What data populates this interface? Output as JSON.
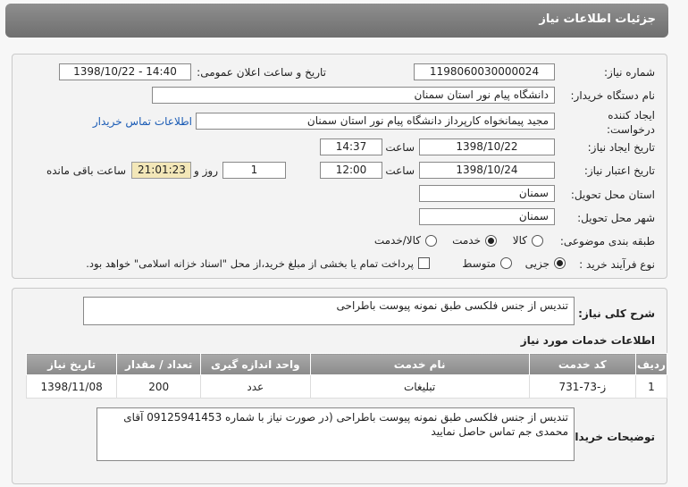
{
  "header": {
    "title": "جزئیات اطلاعات نیاز"
  },
  "fields": {
    "need_number_label": "شماره نیاز:",
    "need_number": "1198060030000024",
    "announce_label": "تاریخ و ساعت اعلان عمومی:",
    "announce_value": "1398/10/22 - 14:40",
    "buyer_label": "نام دستگاه خریدار:",
    "buyer_value": "دانشگاه  پیام نور استان سمنان",
    "creator_label_1": "ایجاد کننده",
    "creator_label_2": "درخواست:",
    "creator_value": "مجید پیمانخواه کارپرداز دانشگاه  پیام نور استان سمنان",
    "contact_link": "اطلاعات تماس خریدار",
    "create_date_label": "تاریخ ایجاد نیاز:",
    "create_date": "1398/10/22",
    "time_label": "ساعت",
    "create_time": "14:37",
    "valid_date_label": "تاریخ اعتبار نیاز:",
    "valid_date": "1398/10/24",
    "valid_time": "12:00",
    "days": "1",
    "days_label": "روز و",
    "remaining": "21:01:23",
    "remaining_label": "ساعت باقی مانده",
    "province_label": "استان محل تحویل:",
    "province": "سمنان",
    "city_label": "شهر محل تحویل:",
    "city": "سمنان",
    "category_label": "طبقه بندی موضوعی:",
    "category_options": [
      "کالا",
      "خدمت",
      "کالا/خدمت"
    ],
    "category_selected": "خدمت",
    "process_label": "نوع فرآیند خرید :",
    "process_options": [
      "جزیی",
      "متوسط"
    ],
    "process_selected": "جزیی",
    "payment_note": "پرداخت تمام یا بخشی از مبلغ خرید،از محل \"اسناد خزانه اسلامی\" خواهد بود."
  },
  "description": {
    "label": "شرح کلی نیاز:",
    "value": "تندیس از جنس فلکسی طبق نمونه پیوست باطراحی"
  },
  "services": {
    "title": "اطلاعات خدمات مورد نیاز",
    "columns": [
      "ردیف",
      "کد خدمت",
      "نام خدمت",
      "واحد اندازه گیری",
      "تعداد / مقدار",
      "تاریخ نیاز"
    ],
    "rows": [
      [
        "1",
        "ز-73-731",
        "تبلیغات",
        "عدد",
        "200",
        "1398/11/08"
      ]
    ]
  },
  "buyer_notes": {
    "label": "توضیحات خریدار:",
    "value": "تندیس از جنس فلکسی طبق نمونه پیوست باطراحی (در صورت نیاز با شماره  09125941453 آقای محمدی جم تماس حاصل نمایید"
  }
}
